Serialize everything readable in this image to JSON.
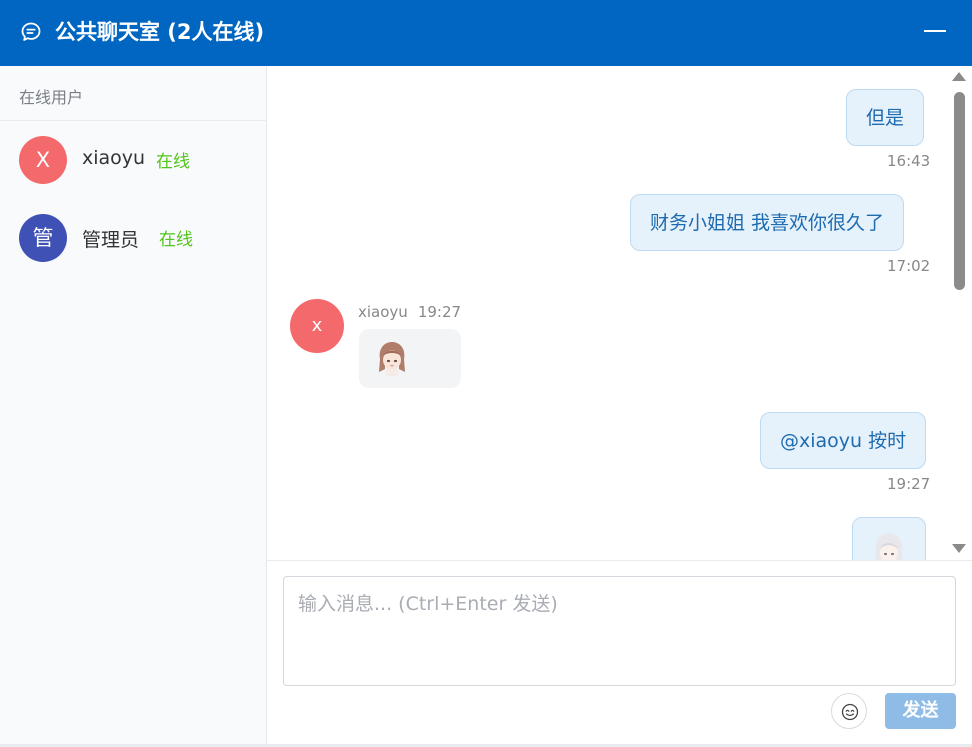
{
  "header": {
    "title": "公共聊天室 (2人在线)",
    "icon": "chat-bubble-icon",
    "minimize_icon": "minimize-icon"
  },
  "sidebar": {
    "title": "在线用户",
    "users": [
      {
        "avatar_letter": "X",
        "name": "xiaoyu",
        "status": "在线",
        "avatar_color": "#f4696b"
      },
      {
        "avatar_letter": "管",
        "name": "管理员",
        "status": "在线",
        "avatar_color": "#3f51b5"
      }
    ]
  },
  "messages": [
    {
      "direction": "out",
      "text": "但是",
      "time": "16:43"
    },
    {
      "direction": "out",
      "text": "财务小姐姐 我喜欢你很久了",
      "time": "17:02"
    },
    {
      "direction": "in",
      "sender": "xiaoyu",
      "avatar_letter": "x",
      "time": "19:27",
      "content": "sticker-image"
    },
    {
      "direction": "out",
      "text": "@xiaoyu 按时",
      "time": "19:27"
    },
    {
      "direction": "out",
      "content": "sticker-image"
    }
  ],
  "composer": {
    "placeholder": "输入消息... (Ctrl+Enter 发送)",
    "value": "",
    "emoji_icon": "emoji-icon",
    "send_label": "发送"
  },
  "colors": {
    "header_bg": "#0066c2",
    "online": "#52c41a",
    "bubble_out_bg": "#e6f2fb",
    "bubble_out_text": "#1e6bb0",
    "send_button": "#8fbce6"
  }
}
